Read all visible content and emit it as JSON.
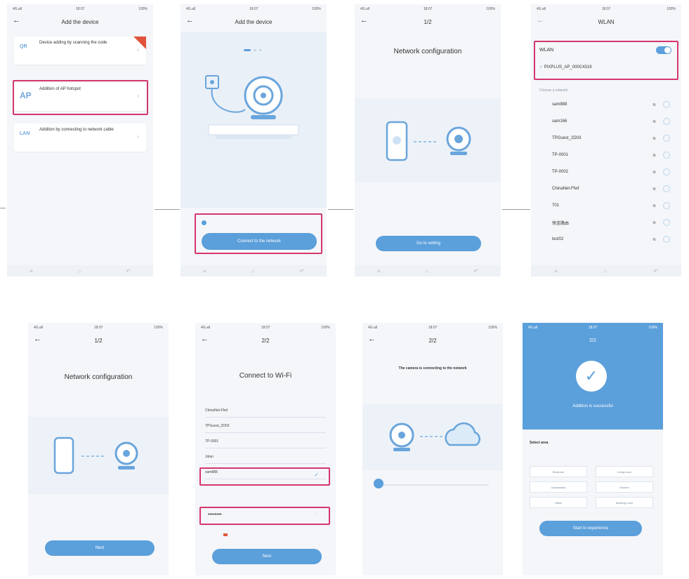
{
  "status": {
    "time": "18:07",
    "signal": "4G.all",
    "battery": "100%"
  },
  "s1": {
    "title": "Add the device",
    "cards": [
      {
        "icon": "QR",
        "title": "Device adding by scanning the code",
        "desc": ""
      },
      {
        "icon": "AP",
        "title": "Addition of AP hotspot",
        "desc": ""
      },
      {
        "icon": "LAN",
        "title": "Addition by connecting to network cable",
        "desc": ""
      }
    ]
  },
  "s2": {
    "title": "Add the device",
    "button": "Connect to the network"
  },
  "s3": {
    "step": "1/2",
    "title": "Network configuration",
    "button": "Go to setting"
  },
  "s4": {
    "title": "WLAN",
    "wlan_label": "WLAN",
    "connected": "PIXPLUS_AP_000C4319",
    "choose": "Choose a network",
    "networks": [
      "sam888",
      "sam166",
      "TPGuest_2D03",
      "TP-0001",
      "TP-0002",
      "ChinaNet-Ffwf",
      "701",
      "快连路由",
      "test02"
    ]
  },
  "s5": {
    "step": "1/2",
    "title": "Network configuration",
    "button": "Next"
  },
  "s6": {
    "step": "2/2",
    "title": "Connect to Wi-Fi",
    "networks": [
      "ChinaNet-Ffwf",
      "TPGuest_2D03",
      "TP-0001",
      "Jolan",
      "sam888"
    ],
    "password": "••••••••",
    "button": "Next"
  },
  "s7": {
    "step": "2/2",
    "title": "The camera is connecting to the network"
  },
  "s8": {
    "step": "2/2",
    "success": "Addition is successful",
    "section": "Select area",
    "rooms": [
      "Bedroom",
      "Living room",
      "Gymnastics",
      "Kitchen",
      "Office",
      "Meeting room"
    ],
    "button": "Start to experience"
  },
  "colors": {
    "accent": "#5b9fdb",
    "highlight": "#d6366f"
  }
}
